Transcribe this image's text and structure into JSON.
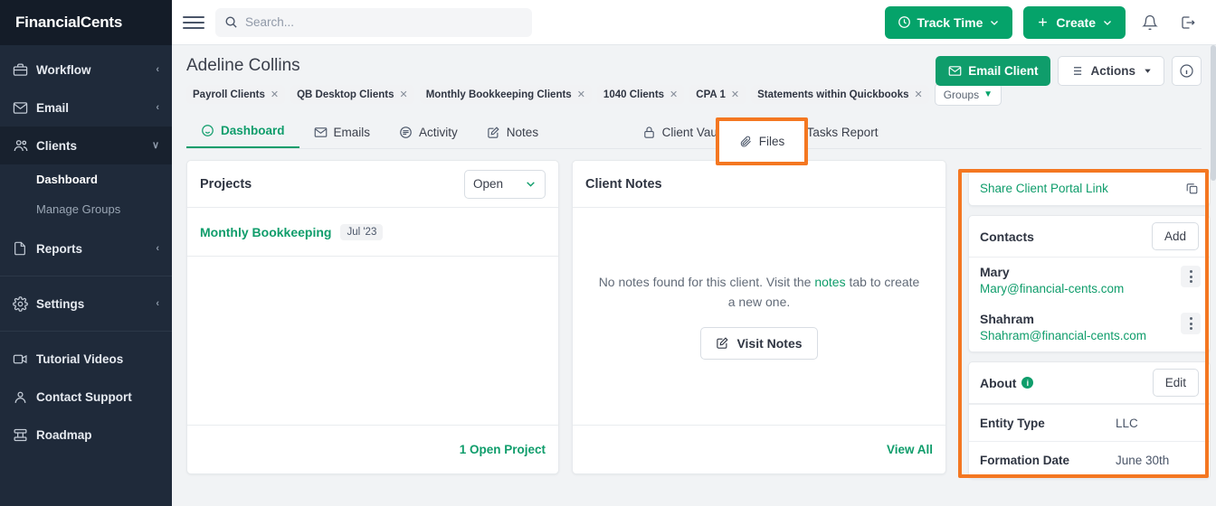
{
  "brand": {
    "name": "FinancialCents"
  },
  "sidebar": {
    "items": [
      {
        "label": "Workflow",
        "icon": "briefcase-icon",
        "chevron": "‹"
      },
      {
        "label": "Email",
        "icon": "envelope-icon",
        "chevron": "‹"
      },
      {
        "label": "Clients",
        "icon": "users-icon",
        "chevron": "∨"
      },
      {
        "label": "Reports",
        "icon": "document-icon",
        "chevron": "‹"
      },
      {
        "label": "Settings",
        "icon": "gear-icon",
        "chevron": "‹"
      },
      {
        "label": "Tutorial Videos",
        "icon": "video-icon",
        "chevron": ""
      },
      {
        "label": "Contact Support",
        "icon": "person-icon",
        "chevron": ""
      },
      {
        "label": "Roadmap",
        "icon": "roadmap-icon",
        "chevron": ""
      }
    ],
    "sub_items": [
      {
        "label": "Dashboard",
        "selected": true
      },
      {
        "label": "Manage Groups",
        "selected": false
      }
    ]
  },
  "topbar": {
    "search_placeholder": "Search...",
    "search_value": "",
    "track_time_label": "Track Time",
    "create_label": "Create",
    "notification_icon": "bell-icon",
    "logout_icon": "logout-icon"
  },
  "client": {
    "name": "Adeline Collins",
    "tags": [
      "Payroll Clients",
      "QB Desktop Clients",
      "Monthly Bookkeeping Clients",
      "1040 Clients",
      "CPA 1",
      "Statements within Quickbooks"
    ],
    "groups_label": "Groups",
    "email_client_label": "Email Client",
    "actions_label": "Actions"
  },
  "tabs": [
    {
      "label": "Dashboard",
      "icon": "dashboard-icon",
      "active": true
    },
    {
      "label": "Emails",
      "icon": "envelope-icon",
      "active": false
    },
    {
      "label": "Activity",
      "icon": "activity-icon",
      "active": false
    },
    {
      "label": "Notes",
      "icon": "note-icon",
      "active": false
    },
    {
      "label": "Files",
      "icon": "paperclip-icon",
      "active": false,
      "highlighted": true
    },
    {
      "label": "Client Vault",
      "icon": "lock-icon",
      "active": false
    },
    {
      "label": "Client Tasks Report",
      "icon": "list-icon",
      "active": false
    }
  ],
  "projects_card": {
    "title": "Projects",
    "filter_value": "Open",
    "rows": [
      {
        "name": "Monthly Bookkeeping",
        "date": "Jul '23"
      }
    ],
    "footer_link": "1 Open Project"
  },
  "notes_card": {
    "title": "Client Notes",
    "empty_text_before": "No notes found for this client. Visit the ",
    "empty_link": "notes",
    "empty_text_after": " tab to create a new one.",
    "visit_button": "Visit Notes",
    "footer_link": "View All"
  },
  "right_panel": {
    "share_link_label": "Share Client Portal Link",
    "copy_icon": "copy-icon",
    "contacts_title": "Contacts",
    "contacts_add_label": "Add",
    "contacts": [
      {
        "name": "Mary",
        "email": "Mary@financial-cents.com"
      },
      {
        "name": "Shahram",
        "email": "Shahram@financial-cents.com"
      }
    ],
    "about_title": "About",
    "about_info_badge": "i",
    "about_edit_label": "Edit",
    "about_rows": [
      {
        "key": "Entity Type",
        "value": "LLC"
      },
      {
        "key": "Formation Date",
        "value": "June 30th"
      }
    ]
  },
  "highlight": {
    "color": "#f47721"
  }
}
